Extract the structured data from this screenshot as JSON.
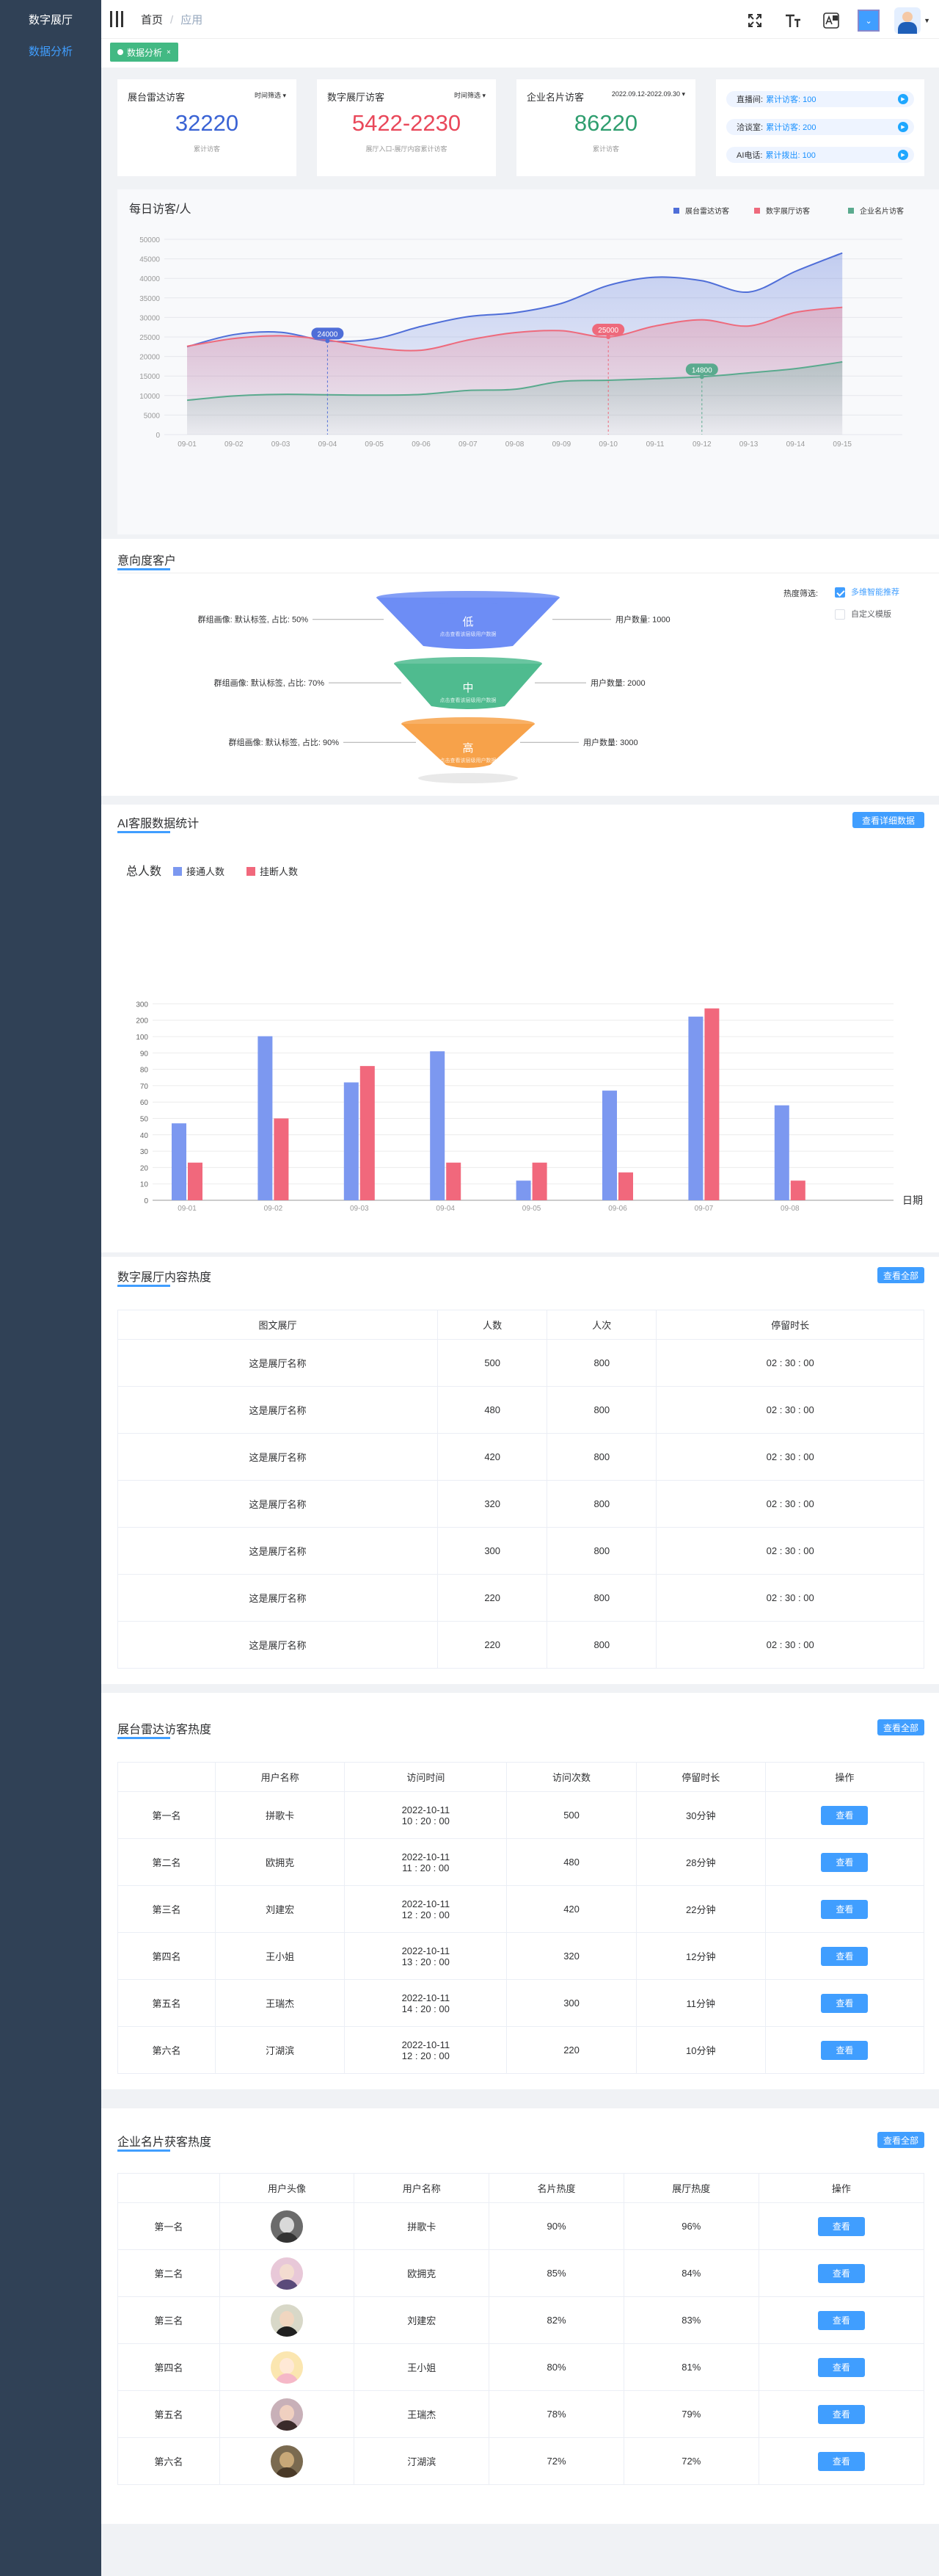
{
  "sidebar": {
    "title": "数字展厅",
    "items": [
      {
        "label": "数据分析"
      }
    ]
  },
  "header": {
    "breadcrumb": [
      {
        "label": "首页"
      },
      {
        "label": "应用"
      }
    ],
    "icons": {
      "fullscreen": "fullscreen-icon",
      "font_size": "font-size-icon",
      "translate": "translate-icon"
    }
  },
  "tabs": [
    {
      "label": "数据分析"
    }
  ],
  "stats": [
    {
      "title": "展台雷达访客",
      "filter": "时间筛选 ▾",
      "value": "32220",
      "sub": "累计访客",
      "color": "#3a63d4"
    },
    {
      "title": "数字展厅访客",
      "filter": "时间筛选 ▾",
      "value": "5422-2230",
      "sub": "展厅入口-展厅内容累计访客",
      "color": "#e9485a"
    },
    {
      "title": "企业名片访客",
      "filter": "2022.09.12-2022.09.30 ▾",
      "value": "86220",
      "sub": "累计访客",
      "color": "#2f9e6f"
    }
  ],
  "right_panel": [
    {
      "label": "直播间:",
      "value": "累计访客: 100"
    },
    {
      "label": "洽谈室:",
      "value": "累计访客: 200"
    },
    {
      "label": "AI电话:",
      "value": "累计拨出: 100"
    }
  ],
  "visitor_chart": {
    "title": "每日访客/人",
    "legend": [
      "展台雷达访客",
      "数字展厅访客",
      "企业名片访客"
    ],
    "colors": [
      "#4f6ed8",
      "#ee6a7c",
      "#5aaa8e"
    ],
    "chart_data": {
      "type": "area",
      "x": [
        "09-01",
        "09-02",
        "09-03",
        "09-04",
        "09-05",
        "09-06",
        "09-07",
        "09-08",
        "09-09",
        "09-10",
        "09-11",
        "09-12",
        "09-13",
        "09-14",
        "09-15"
      ],
      "ylim": [
        0,
        50000
      ],
      "yticks": [
        0,
        5000,
        10000,
        15000,
        20000,
        25000,
        30000,
        35000,
        40000,
        45000,
        50000
      ],
      "series": [
        {
          "name": "展台雷达访客",
          "values": [
            22500,
            25600,
            26200,
            24000,
            24500,
            27700,
            30200,
            31200,
            33600,
            38200,
            40300,
            39400,
            36500,
            41800,
            46500
          ]
        },
        {
          "name": "数字展厅访客",
          "values": [
            22600,
            24600,
            25300,
            24200,
            22200,
            21600,
            24200,
            26100,
            26600,
            25000,
            27800,
            29400,
            27800,
            31300,
            32600
          ]
        },
        {
          "name": "企业名片访客",
          "values": [
            8800,
            9900,
            10300,
            10200,
            10100,
            10300,
            11300,
            11600,
            13600,
            13900,
            14300,
            14800,
            15800,
            16900,
            18600
          ]
        }
      ],
      "annotations": [
        {
          "x": "09-04",
          "value": 24000,
          "label": "24000",
          "series": 0
        },
        {
          "x": "09-10",
          "value": 25000,
          "label": "25000",
          "series": 1
        },
        {
          "x": "09-12",
          "value": 14800,
          "label": "14800",
          "series": 2
        }
      ]
    }
  },
  "intent": {
    "title": "意向度客户",
    "filter_label": "热度筛选:",
    "options": [
      {
        "label": "多维智能推荐",
        "checked": true
      },
      {
        "label": "自定义模版",
        "checked": false
      }
    ],
    "levels": [
      {
        "level": "低",
        "desc": "点击查看该层级用户数据",
        "left": "群组画像: 默认标签, 占比: 50%",
        "right": "用户数量: 1000",
        "color": "#6d8df5"
      },
      {
        "level": "中",
        "desc": "点击查看该层级用户数据",
        "left": "群组画像: 默认标签, 占比: 70%",
        "right": "用户数量: 2000",
        "color": "#4fbb8f"
      },
      {
        "level": "高",
        "desc": "点击查看该层级用户数据",
        "left": "群组画像: 默认标签, 占比: 90%",
        "right": "用户数量: 3000",
        "color": "#f7a24a"
      }
    ]
  },
  "ai_stats": {
    "title": "AI客服数据统计",
    "button": "查看详细数据",
    "chart_data": {
      "type": "bar",
      "title": "总人数",
      "xlabel": "日期",
      "categories": [
        "09-01",
        "09-02",
        "09-03",
        "09-04",
        "09-05",
        "09-06",
        "09-07",
        "09-08"
      ],
      "ylim": [
        0,
        300
      ],
      "yticks": [
        0,
        10,
        20,
        30,
        40,
        50,
        60,
        70,
        80,
        90,
        100,
        200,
        300
      ],
      "series": [
        {
          "name": "接通人数",
          "color": "#7c98f0",
          "values": [
            47,
            102,
            72,
            91,
            12,
            67,
            222,
            58
          ]
        },
        {
          "name": "挂断人数",
          "color": "#f1687c",
          "values": [
            23,
            50,
            82,
            23,
            23,
            17,
            272,
            12
          ]
        }
      ]
    }
  },
  "hall_table": {
    "title": "数字展厅内容热度",
    "button": "查看全部",
    "columns": [
      "图文展厅",
      "人数",
      "人次",
      "停留时长"
    ],
    "rows": [
      [
        "这是展厅名称",
        "500",
        "800",
        "02 : 30 : 00"
      ],
      [
        "这是展厅名称",
        "480",
        "800",
        "02 : 30 : 00"
      ],
      [
        "这是展厅名称",
        "420",
        "800",
        "02 : 30 : 00"
      ],
      [
        "这是展厅名称",
        "320",
        "800",
        "02 : 30 : 00"
      ],
      [
        "这是展厅名称",
        "300",
        "800",
        "02 : 30 : 00"
      ],
      [
        "这是展厅名称",
        "220",
        "800",
        "02 : 30 : 00"
      ],
      [
        "这是展厅名称",
        "220",
        "800",
        "02 : 30 : 00"
      ]
    ]
  },
  "radar_table": {
    "title": "展台雷达访客热度",
    "button": "查看全部",
    "columns": [
      "",
      "用户名称",
      "访问时间",
      "访问次数",
      "停留时长",
      "操作"
    ],
    "rows": [
      {
        "rank": "第一名",
        "name": "拼歌卡",
        "date": "2022-10-11",
        "time": "10 : 20 : 00",
        "count": "500",
        "stay": "30分钟",
        "action": "查看"
      },
      {
        "rank": "第二名",
        "name": "欧拥克",
        "date": "2022-10-11",
        "time": "11 : 20 : 00",
        "count": "480",
        "stay": "28分钟",
        "action": "查看"
      },
      {
        "rank": "第三名",
        "name": "刘建宏",
        "date": "2022-10-11",
        "time": "12 : 20 : 00",
        "count": "420",
        "stay": "22分钟",
        "action": "查看"
      },
      {
        "rank": "第四名",
        "name": "王小姐",
        "date": "2022-10-11",
        "time": "13 : 20 : 00",
        "count": "320",
        "stay": "12分钟",
        "action": "查看"
      },
      {
        "rank": "第五名",
        "name": "王瑞杰",
        "date": "2022-10-11",
        "time": "14 : 20 : 00",
        "count": "300",
        "stay": "11分钟",
        "action": "查看"
      },
      {
        "rank": "第六名",
        "name": "汀湖滨",
        "date": "2022-10-11",
        "time": "12 : 20 : 00",
        "count": "220",
        "stay": "10分钟",
        "action": "查看"
      }
    ]
  },
  "card_table": {
    "title": "企业名片获客热度",
    "button": "查看全部",
    "columns": [
      "",
      "用户头像",
      "用户名称",
      "名片热度",
      "展厅热度",
      "操作"
    ],
    "rows": [
      {
        "rank": "第一名",
        "avatar": {
          "bg": "#6b6b6b",
          "face": "#d9d9d9",
          "body": "#333333"
        },
        "name": "拼歌卡",
        "card": "90%",
        "hall": "96%",
        "action": "查看"
      },
      {
        "rank": "第二名",
        "avatar": {
          "bg": "#e8c8d8",
          "face": "#f3dcd0",
          "body": "#5a4a7a"
        },
        "name": "欧拥克",
        "card": "85%",
        "hall": "84%",
        "action": "查看"
      },
      {
        "rank": "第三名",
        "avatar": {
          "bg": "#d8d8c8",
          "face": "#f0d6c0",
          "body": "#202020"
        },
        "name": "刘建宏",
        "card": "82%",
        "hall": "83%",
        "action": "查看"
      },
      {
        "rank": "第四名",
        "avatar": {
          "bg": "#fbe6b0",
          "face": "#ffe9d6",
          "body": "#f5b8c8"
        },
        "name": "王小姐",
        "card": "80%",
        "hall": "81%",
        "action": "查看"
      },
      {
        "rank": "第五名",
        "avatar": {
          "bg": "#c8b0b8",
          "face": "#f0d0c0",
          "body": "#3a2a2a"
        },
        "name": "王瑞杰",
        "card": "78%",
        "hall": "79%",
        "action": "查看"
      },
      {
        "rank": "第六名",
        "avatar": {
          "bg": "#7a6a50",
          "face": "#c8a878",
          "body": "#4a3a28"
        },
        "name": "汀湖滨",
        "card": "72%",
        "hall": "72%",
        "action": "查看"
      }
    ]
  }
}
